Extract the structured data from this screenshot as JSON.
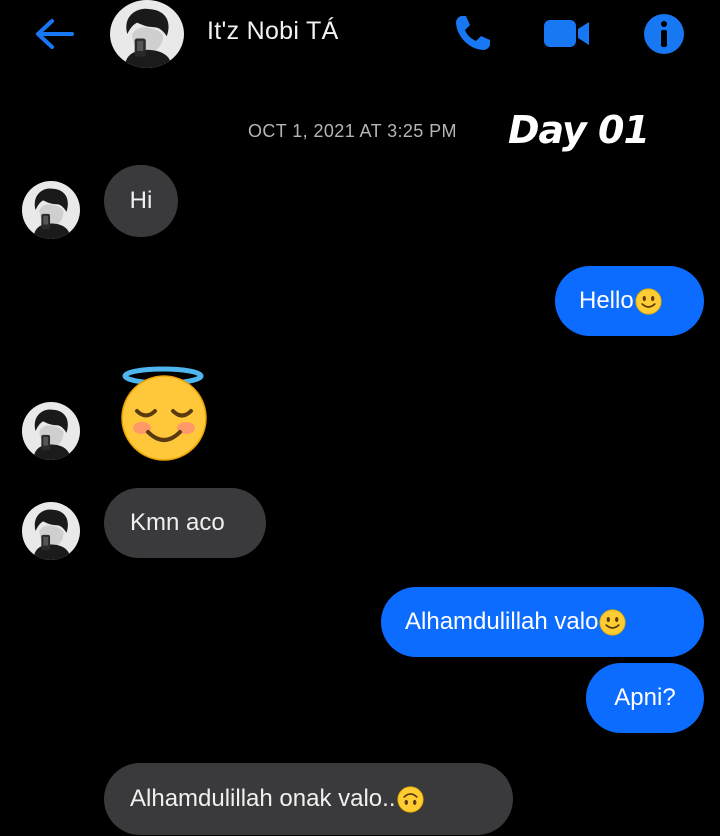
{
  "header": {
    "contact_name": "It'z Nobi TÁ",
    "back_icon": "arrow-left-icon",
    "call_icon": "phone-icon",
    "video_icon": "video-camera-icon",
    "info_icon": "info-icon",
    "accent_color": "#1877f2"
  },
  "conversation": {
    "timestamp": "OCT 1, 2021 AT 3:25 PM",
    "day_label": "Day 01",
    "messages": [
      {
        "from": "contact",
        "text": "Hi"
      },
      {
        "from": "me",
        "text": "Hello",
        "emoji": "slightly-smiling-face"
      },
      {
        "from": "contact",
        "emoji": "smiling-face-with-halo"
      },
      {
        "from": "contact",
        "text": "Kmn aco"
      },
      {
        "from": "me",
        "text": "Alhamdulillah valo",
        "emoji": "slightly-smiling-face"
      },
      {
        "from": "me",
        "text": "Apni?"
      },
      {
        "from": "contact",
        "text": "Alhamdulillah onak valo..",
        "emoji": "upside-down-face"
      }
    ]
  },
  "colors": {
    "outgoing_bubble": "#0b6cff",
    "incoming_bubble": "#3a3a3c",
    "background": "#000000"
  }
}
